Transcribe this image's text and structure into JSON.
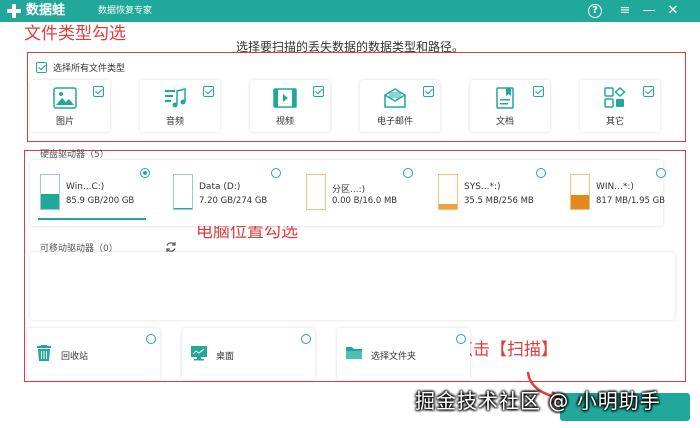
{
  "titlebar": {
    "app_name": "数据蛙",
    "app_subtitle": "数据恢复专家",
    "help": "?",
    "menu": "≡",
    "minimize": "—",
    "close": "✕"
  },
  "subtitle": "选择要扫描的丢失数据的数据类型和路径。",
  "annotations": {
    "file_type": "文件类型勾选",
    "location": "电脑位置勾选",
    "scan": "点击【扫描】"
  },
  "select_all_label": "选择所有文件类型",
  "file_types": [
    {
      "label": "图片",
      "icon": "image-icon",
      "checked": true
    },
    {
      "label": "音频",
      "icon": "music-icon",
      "checked": true
    },
    {
      "label": "视频",
      "icon": "video-icon",
      "checked": true
    },
    {
      "label": "电子邮件",
      "icon": "mail-icon",
      "checked": true
    },
    {
      "label": "文档",
      "icon": "document-icon",
      "checked": true
    },
    {
      "label": "其它",
      "icon": "other-icon",
      "checked": true
    }
  ],
  "hard_drives": {
    "title": "硬盘驱动器（5）",
    "items": [
      {
        "name": "Win...C:)",
        "size": "85.9 GB/200 GB",
        "selected": true,
        "usage": 0.43,
        "color": "#21a89b"
      },
      {
        "name": "Data (D:)",
        "size": "7.20 GB/274 GB",
        "selected": false,
        "usage": 0.03,
        "color": "#21a89b"
      },
      {
        "name": "分区...:)",
        "size": "0.00  B/16.0 MB",
        "selected": false,
        "usage": 0.0,
        "color": "#f0a040"
      },
      {
        "name": "SYS...*:)",
        "size": "35.5 MB/256 MB",
        "selected": false,
        "usage": 0.14,
        "color": "#f0a040"
      },
      {
        "name": "WIN...*:)",
        "size": "817 MB/1.95 GB",
        "selected": false,
        "usage": 0.42,
        "color": "#e08a1e"
      }
    ]
  },
  "removable": {
    "title": "可移动驱动器（0）"
  },
  "locations": [
    {
      "label": "回收站",
      "icon": "recycle-bin-icon"
    },
    {
      "label": "桌面",
      "icon": "desktop-icon"
    },
    {
      "label": "选择文件夹",
      "icon": "folder-icon"
    }
  ],
  "watermark": "掘金技术社区 @ 小明助手",
  "colors": {
    "accent": "#21a89b",
    "annotation": "#e03c3c"
  }
}
